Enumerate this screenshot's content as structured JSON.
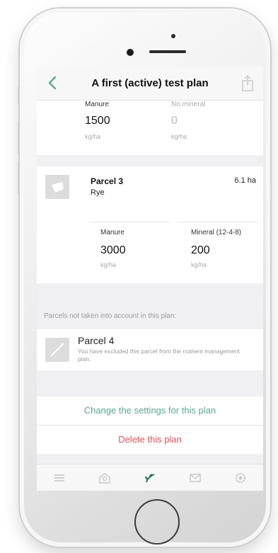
{
  "nav": {
    "title": "A first (active) test plan"
  },
  "parcel_prev": {
    "col1": {
      "label": "Manure",
      "value": "1500",
      "unit": "kg/ha"
    },
    "col2": {
      "label": "No mineral",
      "value": "0",
      "unit": "kg/ha"
    }
  },
  "parcel3": {
    "name": "Parcel 3",
    "crop": "Rye",
    "area": "6.1 ha",
    "col1": {
      "label": "Manure",
      "value": "3000",
      "unit": "kg/ha"
    },
    "col2": {
      "label": "Mineral (12-4-8)",
      "value": "200",
      "unit": "kg/ha"
    }
  },
  "excluded_section": {
    "heading": "Parcels not taken into account in this plan:"
  },
  "parcel4": {
    "name": "Parcel 4",
    "description": "You have excluded this parcel from the nutrient management plan."
  },
  "actions": {
    "change_settings": "Change the settings for this plan",
    "delete": "Delete this plan"
  },
  "tabs": [
    "menu-icon",
    "farm-icon",
    "plant-icon",
    "mail-icon",
    "settings-icon"
  ],
  "colors": {
    "accent_green": "#5aa693",
    "danger_red": "#e0505a"
  }
}
